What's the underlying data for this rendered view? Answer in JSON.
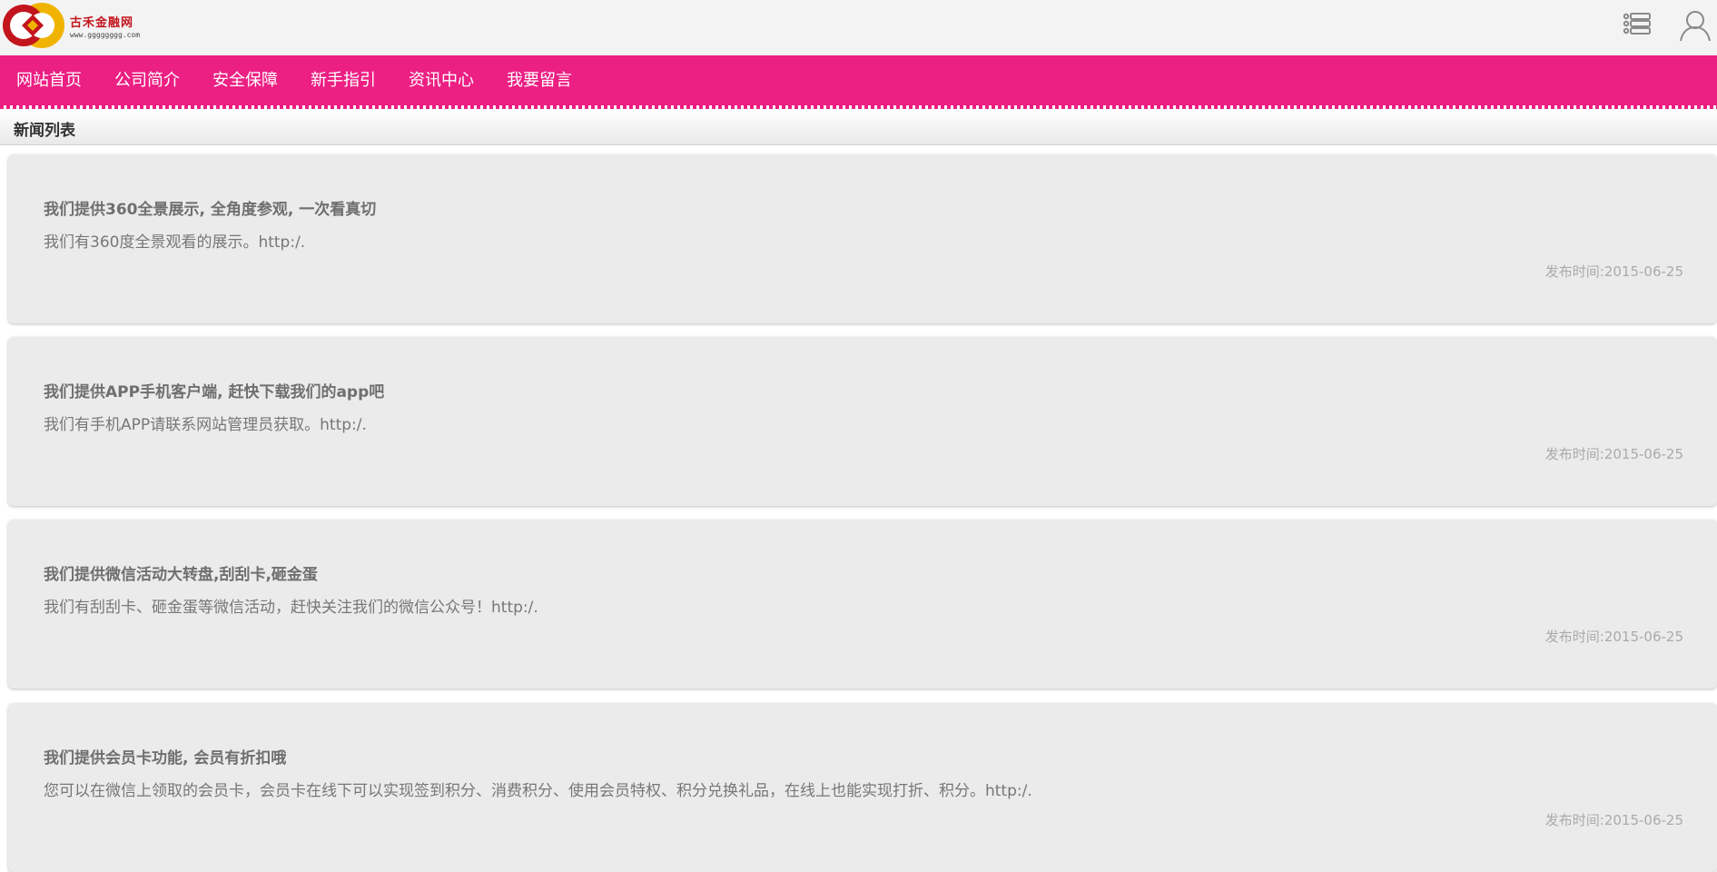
{
  "brand": {
    "name": "古禾金融网",
    "url": "www.gggggggg.com",
    "colors": {
      "red": "#c2151d",
      "gold": "#f0b400"
    }
  },
  "header": {
    "menu_icon": "list-menu-icon",
    "user_icon": "user-icon"
  },
  "nav": {
    "color": "#ec1f83",
    "items": [
      {
        "label": "网站首页"
      },
      {
        "label": "公司简介"
      },
      {
        "label": "安全保障"
      },
      {
        "label": "新手指引"
      },
      {
        "label": "资讯中心"
      },
      {
        "label": "我要留言"
      }
    ]
  },
  "section": {
    "title": "新闻列表"
  },
  "news": [
    {
      "title": "我们提供360全景展示, 全角度参观, 一次看真切",
      "summary": "我们有360度全景观看的展示。http:/.",
      "date": "发布时间:2015-06-25"
    },
    {
      "title": "我们提供APP手机客户端, 赶快下载我们的app吧",
      "summary": "我们有手机APP请联系网站管理员获取。http:/.",
      "date": "发布时间:2015-06-25"
    },
    {
      "title": "我们提供微信活动大转盘,刮刮卡,砸金蛋",
      "summary": "我们有刮刮卡、砸金蛋等微信活动，赶快关注我们的微信公众号！http:/.",
      "date": "发布时间:2015-06-25"
    },
    {
      "title": "我们提供会员卡功能, 会员有折扣哦",
      "summary": "您可以在微信上领取的会员卡，会员卡在线下可以实现签到积分、消费积分、使用会员特权、积分兑换礼品，在线上也能实现打折、积分。http:/.",
      "date": "发布时间:2015-06-25"
    }
  ]
}
